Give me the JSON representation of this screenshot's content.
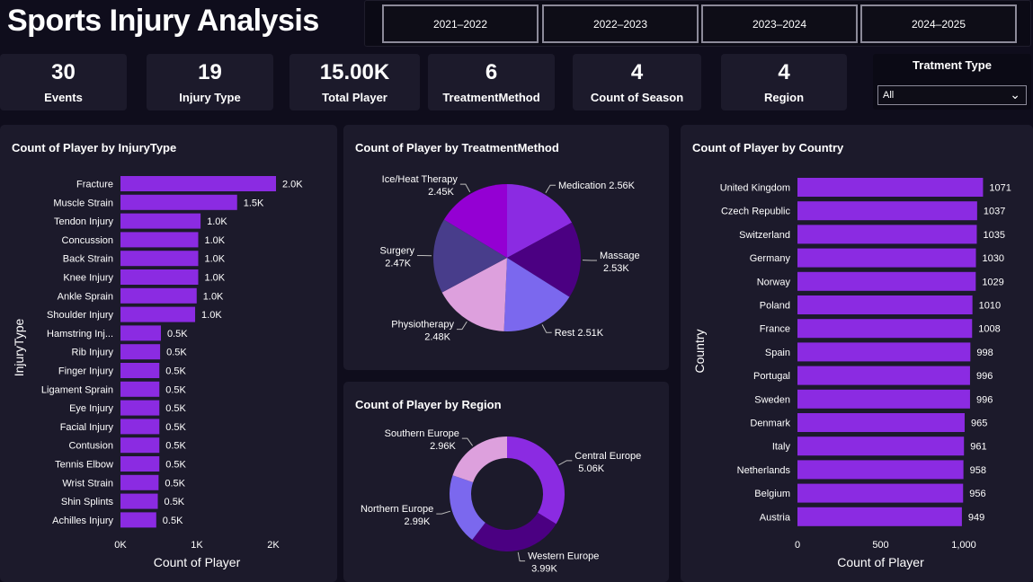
{
  "header": {
    "title": "Sports Injury Analysis"
  },
  "seasons": [
    "2021–2022",
    "2022–2023",
    "2023–2024",
    "2024–2025"
  ],
  "kpis": [
    {
      "value": "30",
      "label": "Events"
    },
    {
      "value": "19",
      "label": "Injury Type"
    },
    {
      "value": "15.00K",
      "label": "Total Player"
    },
    {
      "value": "6",
      "label": "TreatmentMethod"
    },
    {
      "value": "4",
      "label": "Count of Season"
    },
    {
      "value": "4",
      "label": "Region"
    }
  ],
  "slicer": {
    "title": "Tratment Type",
    "value": "All"
  },
  "colors": {
    "bar": "#8b2be2",
    "panel": "#1c1a2b",
    "background": "#0f0d1c"
  },
  "chart_data": [
    {
      "type": "bar",
      "orientation": "horizontal",
      "title": "Count of Player by InjuryType",
      "xlabel": "Count of Player",
      "ylabel": "InjuryType",
      "xlim": [
        0,
        2000
      ],
      "xticks": [
        "0K",
        "1K",
        "2K"
      ],
      "categories": [
        "Fracture",
        "Muscle Strain",
        "Tendon Injury",
        "Concussion",
        "Back Strain",
        "Knee Injury",
        "Ankle Sprain",
        "Shoulder Injury",
        "Hamstring Inj...",
        "Rib Injury",
        "Finger Injury",
        "Ligament Sprain",
        "Eye Injury",
        "Facial Injury",
        "Contusion",
        "Tennis Elbow",
        "Wrist Strain",
        "Shin Splints",
        "Achilles Injury"
      ],
      "values": [
        2000,
        1500,
        1030,
        1000,
        1000,
        1000,
        980,
        960,
        520,
        510,
        500,
        500,
        500,
        500,
        500,
        500,
        490,
        480,
        460
      ],
      "data_labels": [
        "2.0K",
        "1.5K",
        "1.0K",
        "1.0K",
        "1.0K",
        "1.0K",
        "1.0K",
        "1.0K",
        "0.5K",
        "0.5K",
        "0.5K",
        "0.5K",
        "0.5K",
        "0.5K",
        "0.5K",
        "0.5K",
        "0.5K",
        "0.5K",
        "0.5K"
      ]
    },
    {
      "type": "pie",
      "title": "Count of Player by TreatmentMethod",
      "categories": [
        "Medication",
        "Massage",
        "Rest",
        "Physiotherapy",
        "Surgery",
        "Ice/Heat Therapy"
      ],
      "values": [
        2560,
        2530,
        2510,
        2480,
        2470,
        2450
      ],
      "data_labels": [
        "2.56K",
        "2.53K",
        "2.51K",
        "2.48K",
        "2.47K",
        "2.45K"
      ],
      "colors": [
        "#8b2be2",
        "#4b0082",
        "#7b68ee",
        "#dda0dd",
        "#483d8b",
        "#9400d3"
      ]
    },
    {
      "type": "donut",
      "title": "Count of Player by Region",
      "categories": [
        "Central Europe",
        "Western Europe",
        "Northern Europe",
        "Southern Europe"
      ],
      "values": [
        5060,
        3990,
        2990,
        2960
      ],
      "data_labels": [
        "5.06K",
        "3.99K",
        "2.99K",
        "2.96K"
      ],
      "colors": [
        "#8b2be2",
        "#4b0082",
        "#7b68ee",
        "#dda0dd"
      ]
    },
    {
      "type": "bar",
      "orientation": "horizontal",
      "title": "Count of Player by Country",
      "xlabel": "Count of Player",
      "ylabel": "Country",
      "xlim": [
        0,
        1100
      ],
      "xticks": [
        "0",
        "500",
        "1,000"
      ],
      "categories": [
        "United Kingdom",
        "Czech Republic",
        "Switzerland",
        "Germany",
        "Norway",
        "Poland",
        "France",
        "Spain",
        "Portugal",
        "Sweden",
        "Denmark",
        "Italy",
        "Netherlands",
        "Belgium",
        "Austria"
      ],
      "values": [
        1071,
        1037,
        1035,
        1030,
        1029,
        1010,
        1008,
        998,
        996,
        996,
        965,
        961,
        958,
        956,
        949
      ]
    }
  ]
}
